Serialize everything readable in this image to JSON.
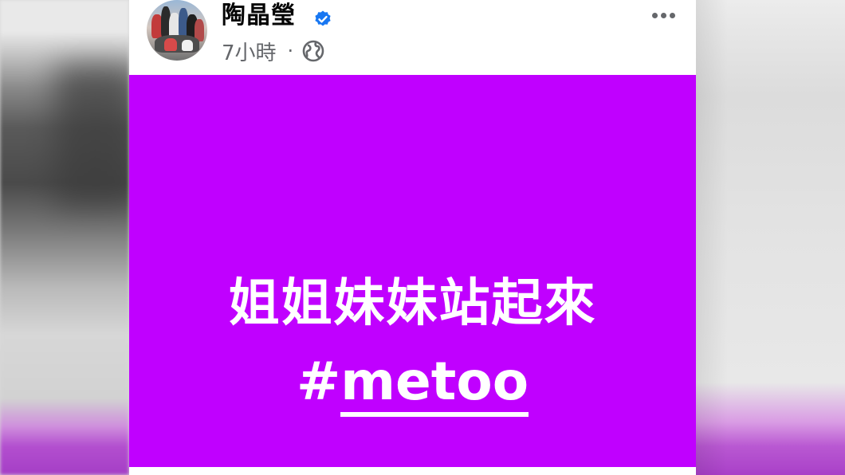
{
  "post": {
    "author": "陶晶瑩",
    "verified": true,
    "timestamp": "7小時",
    "separator": "·",
    "audience_icon": "globe-icon",
    "more_icon": "more-horizontal-icon"
  },
  "media": {
    "background_color": "#c000ff",
    "line1": "姐姐妹妹站起來",
    "hash_symbol": "#",
    "hashtag": "metoo"
  },
  "colors": {
    "verified_badge": "#1877f2",
    "meta_text": "#65676b",
    "media_text": "#ffffff"
  }
}
